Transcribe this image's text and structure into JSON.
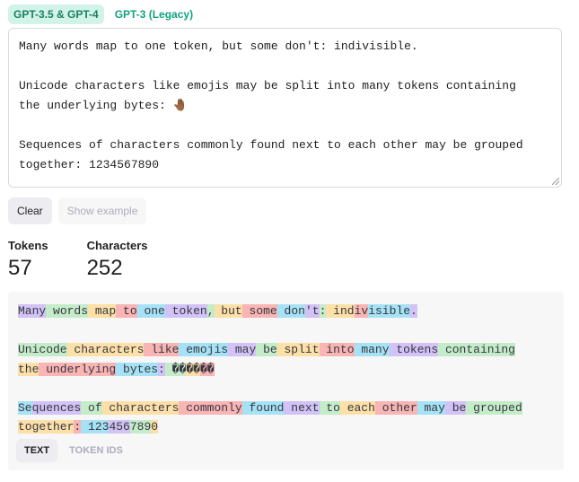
{
  "model_tabs": [
    "GPT-3.5 & GPT-4",
    "GPT-3 (Legacy)"
  ],
  "input_text": "Many words map to one token, but some don't: indivisible.\n\nUnicode characters like emojis may be split into many tokens containing\nthe underlying bytes: 🤚🏾\n\nSequences of characters commonly found next to each other may be grouped\ntogether: 1234567890",
  "buttons": {
    "clear": "Clear",
    "show_example": "Show example"
  },
  "stats": {
    "tokens_label": "Tokens",
    "tokens_value": "57",
    "characters_label": "Characters",
    "characters_value": "252"
  },
  "token_colors": [
    "#d3c2f5",
    "#c5ecc9",
    "#fce0a8",
    "#f9b4b4",
    "#a6e2f5"
  ],
  "tokens": [
    "Many",
    " words",
    " map",
    " to",
    " one",
    " token",
    ",",
    " but",
    " some",
    " don",
    "'t",
    ":",
    " ind",
    "iv",
    "isible",
    ".",
    "\n\n",
    "Unicode",
    " characters",
    " like",
    " emojis",
    " may",
    " be",
    " split",
    " into",
    " many",
    " tokens",
    " containing",
    "\n",
    "the",
    " underlying",
    " bytes",
    ":",
    " ��",
    "��",
    "��",
    "\n\n",
    "Se",
    "quences",
    " of",
    " characters",
    " commonly",
    " found",
    " next",
    " to",
    " each",
    " other",
    " may",
    " be",
    " grouped",
    "\n",
    "together",
    ":",
    " 123",
    "456",
    "789",
    "0"
  ],
  "view_tabs": [
    "TEXT",
    "TOKEN IDS"
  ]
}
